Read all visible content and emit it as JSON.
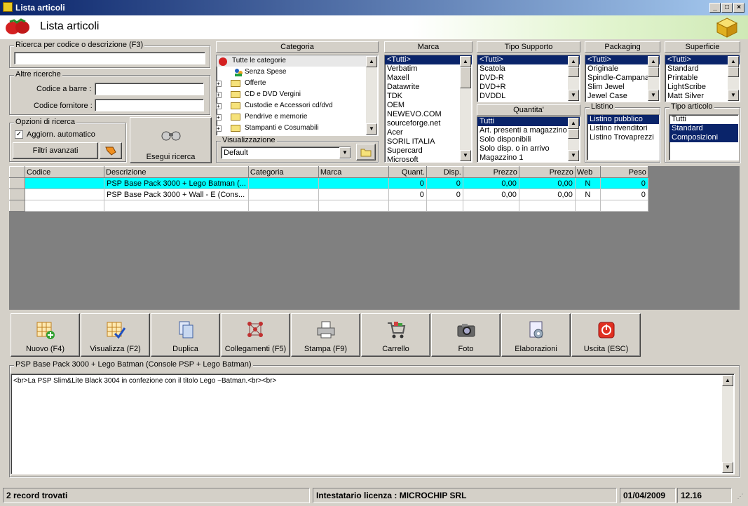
{
  "window": {
    "title": "Lista articoli",
    "header_title": "Lista articoli"
  },
  "search": {
    "code_desc_label": "Ricerca per codice o descrizione (F3)",
    "code_desc_value": "",
    "other_label": "Altre ricerche",
    "barcode_label": "Codice a barre :",
    "supplier_label": "Codice fornitore :",
    "options_label": "Opzioni di ricerca",
    "auto_update_label": "Aggiorn. automatico",
    "advanced_filters_label": "Filtri avanzati",
    "run_label": "Esegui ricerca"
  },
  "categoria": {
    "header": "Categoria",
    "items": [
      "Tutte le categorie",
      "Senza Spese",
      "Offerte",
      "CD e DVD Vergini",
      "Custodie e Accessori cd/dvd",
      "Pendrive e memorie",
      "Stampanti e Cosumabili"
    ],
    "view_label": "Visualizzazione",
    "view_value": "Default"
  },
  "marca": {
    "header": "Marca",
    "items": [
      "<Tutti>",
      "Verbatim",
      "Maxell",
      "Datawrite",
      "TDK",
      "OEM",
      "NEWEVO.COM",
      "sourceforge.net",
      "Acer",
      "SORIL ITALIA",
      "Supercard",
      "Microsoft"
    ]
  },
  "tipo_supporto": {
    "header": "Tipo Supporto",
    "items": [
      "<Tutti>",
      "Scatola",
      "DVD-R",
      "DVD+R",
      "DVDDL"
    ]
  },
  "quantita": {
    "header": "Quantita'",
    "items": [
      "Tutti",
      "Art. presenti a magazzino",
      "Solo disponibili",
      "Solo disp. o in arrivo",
      "Magazzino 1"
    ]
  },
  "packaging": {
    "header": "Packaging",
    "items": [
      "<Tutti>",
      "Originale",
      "Spindle-Campana",
      "Slim Jewel",
      "Jewel Case"
    ]
  },
  "listino": {
    "header": "Listino",
    "items": [
      "Listino pubblico",
      "Listino rivenditori",
      "Listino Trovaprezzi"
    ]
  },
  "superficie": {
    "header": "Superficie",
    "items": [
      "<Tutti>",
      "Standard",
      "Printable",
      "LightScribe",
      "Matt Silver"
    ]
  },
  "tipo_articolo": {
    "header": "Tipo articolo",
    "items": [
      "Tutti",
      "Standard",
      "Composizioni"
    ]
  },
  "table": {
    "columns": [
      "Codice",
      "Descrizione",
      "Categoria",
      "Marca",
      "Quant.",
      "Disp.",
      "Prezzo",
      "Prezzo",
      "Web",
      "Peso"
    ],
    "rows": [
      [
        "",
        "PSP Base Pack 3000 + Lego Batman (...",
        "",
        "",
        "0",
        "0",
        "0,00",
        "0,00",
        "N",
        "0"
      ],
      [
        "",
        "PSP Base Pack 3000 + Wall - E (Cons...",
        "",
        "",
        "0",
        "0",
        "0,00",
        "0,00",
        "N",
        "0"
      ]
    ]
  },
  "toolbar": [
    {
      "label": "Nuovo (F4)",
      "icon": "new-grid-icon"
    },
    {
      "label": "Visualizza (F2)",
      "icon": "view-grid-icon"
    },
    {
      "label": "Duplica",
      "icon": "duplicate-icon"
    },
    {
      "label": "Collegamenti (F5)",
      "icon": "links-icon"
    },
    {
      "label": "Stampa (F9)",
      "icon": "printer-icon"
    },
    {
      "label": "Carrello",
      "icon": "cart-icon"
    },
    {
      "label": "Foto",
      "icon": "camera-icon"
    },
    {
      "label": "Elaborazioni",
      "icon": "process-icon"
    },
    {
      "label": "Uscita (ESC)",
      "icon": "exit-icon"
    }
  ],
  "detail": {
    "label": "PSP Base Pack 3000 + Lego Batman (Console PSP + Lego Batman)",
    "text": "<br>La PSP Slim&Lite Black 3004 in confezione con il titolo Lego ~Batman.<br><br>"
  },
  "status": {
    "records": "2 record trovati",
    "license": "Intestatario licenza : MICROCHIP SRL",
    "date": "01/04/2009",
    "time": "12.16"
  },
  "colors": {
    "selection": "#0a246a",
    "highlight_row": "#00ffff",
    "title_bar": "#0a246a"
  }
}
